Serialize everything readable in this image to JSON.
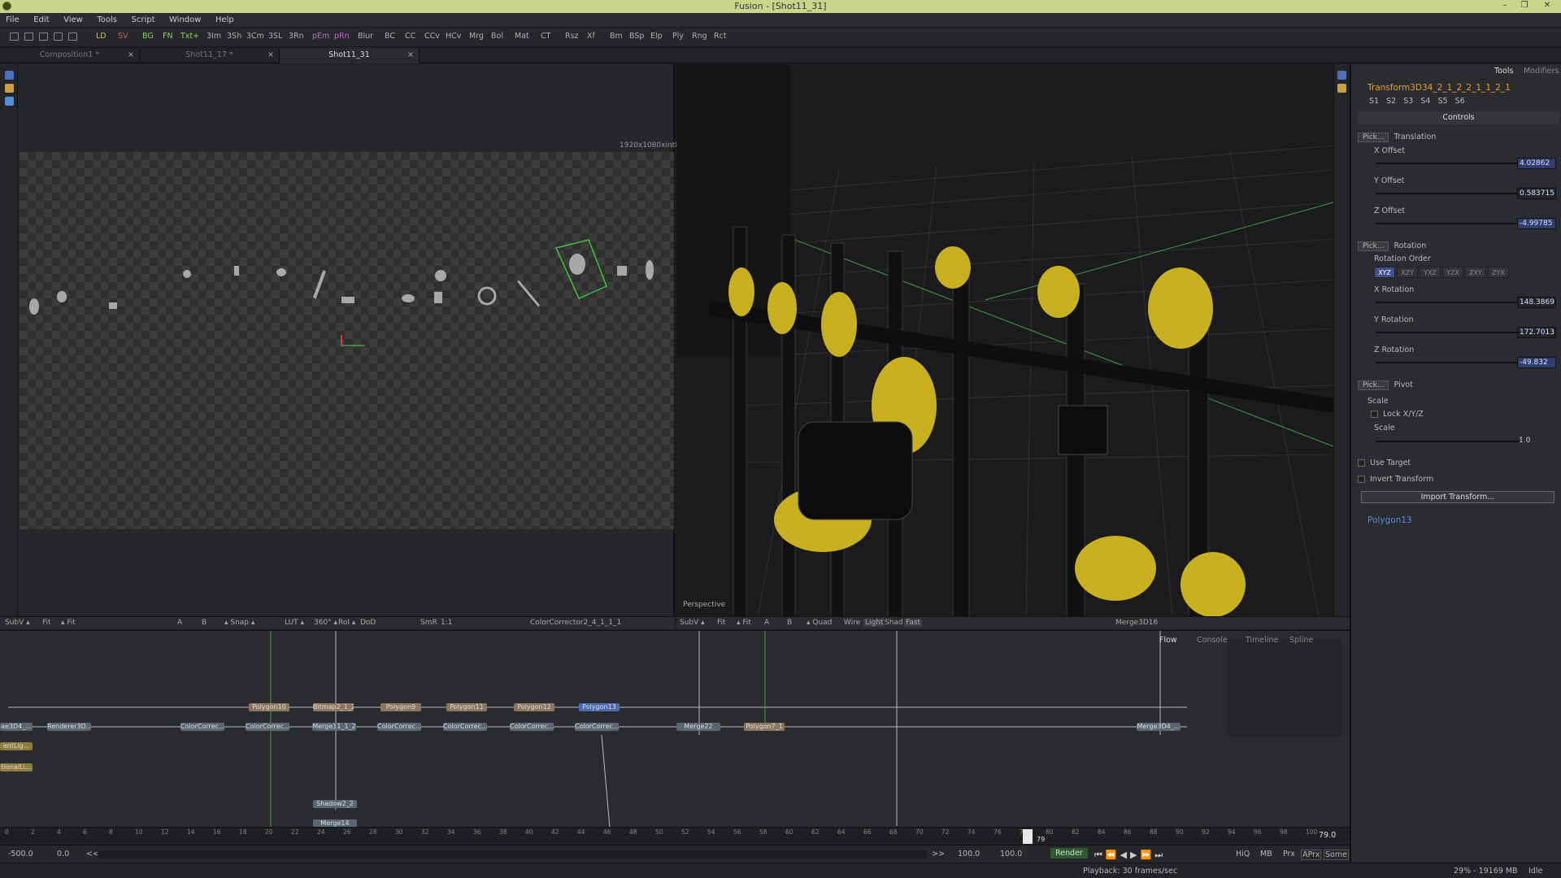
{
  "window": {
    "title": "Fusion - [Shot11_31]",
    "controls": [
      "–",
      "❐",
      "✕"
    ]
  },
  "menu": [
    "File",
    "Edit",
    "View",
    "Tools",
    "Script",
    "Window",
    "Help"
  ],
  "toolbar": [
    "LD",
    "SV",
    "BG",
    "FN",
    "Txt+",
    "3Im",
    "3Sh",
    "3Cm",
    "3SL",
    "3Rn",
    "pEm",
    "pRn",
    "Blur",
    "BC",
    "CC",
    "CCv",
    "HCv",
    "Mrg",
    "Bol",
    "Mat",
    "CT",
    "Rsz",
    "Xf",
    "Bm",
    "BSp",
    "Elp",
    "Ply",
    "Rng",
    "Rct"
  ],
  "tabs": [
    {
      "label": "Composition1 *",
      "close": "×"
    },
    {
      "label": "Shot11_17 *",
      "close": "×"
    },
    {
      "label": "Shot11_31",
      "close": "×"
    }
  ],
  "viewer1": {
    "resolution": "1920x1080xint8",
    "bar": [
      "SubV ▴",
      "Fit",
      "▴ Fit",
      "A",
      "B",
      "▴ Snap ▴",
      "LUT ▴",
      "360° ▴",
      "RoI ▴",
      "DoD",
      "SmR",
      "1:1"
    ],
    "node_name": "ColorCorrector2_4_1_1_1"
  },
  "viewer2": {
    "label": "Perspective",
    "bar": [
      "SubV ▴",
      "Fit",
      "▴ Fit",
      "A",
      "B",
      "▴ Quad",
      "Wire",
      "Light",
      "Shad",
      "Fast"
    ],
    "node_name": "Merge3D16"
  },
  "flow": {
    "tabs": [
      "Flow",
      "Console",
      "Timeline",
      "Spline"
    ],
    "nodes_top": [
      "Polygon10",
      "Bitmap2_1_2",
      "Polygon9",
      "Polygon11",
      "Polygon12",
      "Polygon13"
    ],
    "nodes_main": [
      "ae3D4_...",
      "Renderer3D...",
      "ColorCorrec...",
      "ColorCorrec...",
      "Merge11_1_2",
      "ColorCorrec...",
      "ColorCorrec...",
      "ColorCorrec...",
      "ColorCorrec...",
      "Merge22",
      "Polygon7_1",
      "Merge3D4_..."
    ],
    "nodes_left": [
      "entLig...",
      "tionalLi..."
    ],
    "nodes_bottom": [
      "Shadow2_2",
      "Merge14"
    ]
  },
  "timeline": {
    "ticks": [
      "0",
      "2",
      "4",
      "6",
      "8",
      "10",
      "12",
      "14",
      "16",
      "18",
      "20",
      "22",
      "24",
      "26",
      "28",
      "30",
      "32",
      "34",
      "36",
      "38",
      "40",
      "42",
      "44",
      "46",
      "48",
      "50",
      "52",
      "54",
      "56",
      "58",
      "60",
      "62",
      "64",
      "66",
      "68",
      "70",
      "72",
      "74",
      "76",
      "78",
      "80",
      "82",
      "84",
      "86",
      "88",
      "90",
      "92",
      "94",
      "96",
      "98",
      "100"
    ],
    "current": "79",
    "end": "79.0"
  },
  "transport": {
    "global_start": "-500.0",
    "render_start": "0.0",
    "back": "<<",
    "fwd": ">>",
    "render_end": "100.0",
    "global_end": "100.0",
    "render_btn": "Render",
    "options": [
      "HiQ",
      "MB",
      "Prx",
      "APrx",
      "Some"
    ]
  },
  "status": {
    "playback": "Playback: 30 frames/sec",
    "memory": "29% - 19169 MB",
    "state": "Idle"
  },
  "inspector": {
    "tabs": [
      "Tools",
      "Modifiers"
    ],
    "tool_name": "Transform3D34_2_1_2_2_1_1_2_1",
    "slots": [
      "S1",
      "S2",
      "S3",
      "S4",
      "S5",
      "S6"
    ],
    "controls_header": "Controls",
    "translation": {
      "pick": "Pick...",
      "label": "Translation",
      "x_label": "X Offset",
      "x": "4.02862",
      "y_label": "Y Offset",
      "y": "0.583715",
      "z_label": "Z Offset",
      "z": "-4.99785"
    },
    "rotation": {
      "pick": "Pick...",
      "label": "Rotation",
      "order_label": "Rotation Order",
      "orders": [
        "XYZ",
        "XZY",
        "YXZ",
        "YZX",
        "ZXY",
        "ZYX"
      ],
      "x_label": "X Rotation",
      "x": "148.3869",
      "y_label": "Y Rotation",
      "y": "172.7013",
      "z_label": "Z Rotation",
      "z": "-49.832"
    },
    "pivot": {
      "pick": "Pick...",
      "label": "Pivot"
    },
    "scale": {
      "label": "Scale",
      "lock": "Lock X/Y/Z",
      "scale_label": "Scale",
      "value": "1.0"
    },
    "use_target": "Use Target",
    "invert_transform": "Invert Transform",
    "import_btn": "Import Transform...",
    "next_tool": "Polygon13"
  },
  "colors": {
    "accent": "#e8a030",
    "selection": "#3f5090",
    "titlebar": "#c9d58a"
  }
}
